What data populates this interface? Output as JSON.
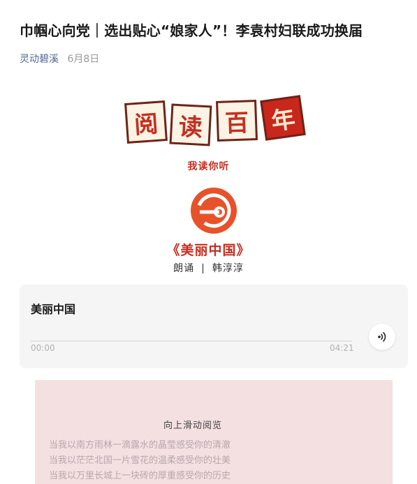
{
  "article": {
    "title": "巾帼心向党｜选出贴心“娘家人”！李袁村妇联成功换届",
    "author": "灵动碧溪",
    "date": "6月8日"
  },
  "banner": {
    "characters": [
      "阅",
      "读",
      "百",
      "年"
    ],
    "subtitle": "我读你听",
    "poem_title": "《美丽中国》",
    "reciter_label": "朗诵",
    "reciter_separator": "|",
    "reciter_name": "韩淳淳",
    "accent_color": "#c9261c"
  },
  "audio": {
    "title": "美丽中国",
    "current_time": "00:00",
    "duration": "04:21",
    "progress": 0,
    "play_icon": "audio-play-icon"
  },
  "scroll_box": {
    "hint": "向上滑动阅览",
    "lines": [
      "当我以南方雨林一滴露水的晶莹感受你的清澈",
      "当我以茫茫北国一片雪花的温柔感受你的壮美",
      "当我以万里长城上一块砖的厚重感受你的历史"
    ],
    "background": "#f4dfe1"
  }
}
